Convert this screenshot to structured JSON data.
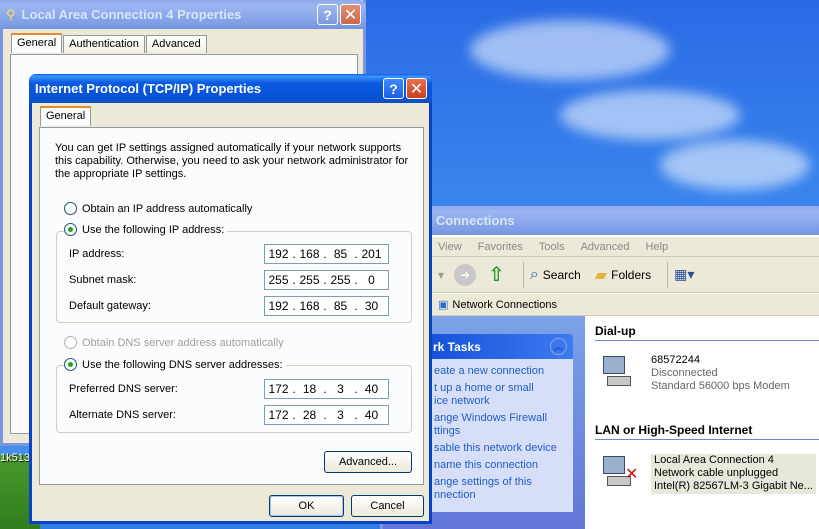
{
  "desktop": {
    "label": "1k513"
  },
  "background_lac_window": {
    "title": "Local Area Connection 4 Properties",
    "help_label": "?",
    "close_label": "✕",
    "tabs": [
      "General",
      "Authentication",
      "Advanced"
    ]
  },
  "network_window": {
    "title": "rk Connections",
    "menu": [
      "View",
      "Favorites",
      "Tools",
      "Advanced",
      "Help"
    ],
    "toolbar": {
      "search": "Search",
      "folders": "Folders"
    },
    "address": "Network Connections",
    "tasks": {
      "title": "rk Tasks",
      "items": [
        "eate a new connection",
        "t up a home or small",
        "ice network",
        "ange Windows Firewall",
        "ttings",
        "sable this network device",
        "name this connection",
        "ange settings of this",
        "nnection"
      ]
    },
    "groups": [
      {
        "title": "Dial-up",
        "item": {
          "name": "68572244",
          "status": "Disconnected",
          "device": "Standard 56000 bps Modem"
        }
      },
      {
        "title": "LAN or High-Speed Internet",
        "item": {
          "name": "Local Area Connection 4",
          "status": "Network cable unplugged",
          "device": "Intel(R) 82567LM-3 Gigabit Ne..."
        }
      }
    ]
  },
  "dialog": {
    "title": "Internet Protocol (TCP/IP) Properties",
    "help_label": "?",
    "close_label": "✕",
    "tab": "General",
    "description": "You can get IP settings assigned automatically if your network supports this capability. Otherwise, you need to ask your network administrator for the appropriate IP settings.",
    "ip_auto": "Obtain an IP address automatically",
    "ip_manual": "Use the following IP address:",
    "ip_fields": [
      {
        "label": "IP address:",
        "octets": [
          "192",
          "168",
          "85",
          "201"
        ]
      },
      {
        "label": "Subnet mask:",
        "octets": [
          "255",
          "255",
          "255",
          "0"
        ]
      },
      {
        "label": "Default gateway:",
        "octets": [
          "192",
          "168",
          "85",
          "30"
        ]
      }
    ],
    "dns_auto": "Obtain DNS server address automatically",
    "dns_manual": "Use the following DNS server addresses:",
    "dns_fields": [
      {
        "label": "Preferred DNS server:",
        "octets": [
          "172",
          "18",
          "3",
          "40"
        ]
      },
      {
        "label": "Alternate DNS server:",
        "octets": [
          "172",
          "28",
          "3",
          "40"
        ]
      }
    ],
    "advanced_label": "Advanced...",
    "ok_label": "OK",
    "cancel_label": "Cancel"
  }
}
